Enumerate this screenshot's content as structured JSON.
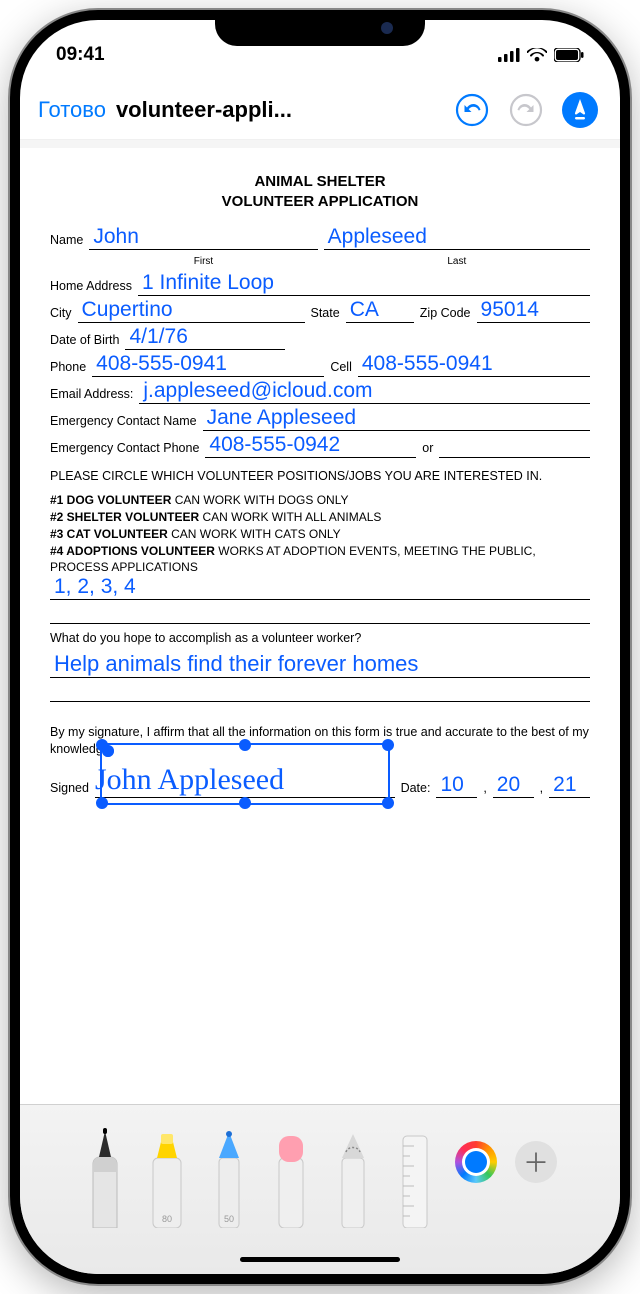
{
  "status": {
    "time": "09:41"
  },
  "nav": {
    "done": "Готово",
    "title": "volunteer-appli..."
  },
  "doc": {
    "heading1": "ANIMAL SHELTER",
    "heading2": "VOLUNTEER APPLICATION",
    "labels": {
      "name": "Name",
      "first": "First",
      "last": "Last",
      "home_address": "Home Address",
      "city": "City",
      "state": "State",
      "zip": "Zip Code",
      "dob": "Date of Birth",
      "phone": "Phone",
      "cell": "Cell",
      "email": "Email Address:",
      "ec_name": "Emergency Contact Name",
      "ec_phone": "Emergency Contact Phone",
      "or": "or",
      "signed": "Signed",
      "date": "Date:"
    },
    "values": {
      "first": "John",
      "last": "Appleseed",
      "address": "1 Infinite Loop",
      "city": "Cupertino",
      "state": "CA",
      "zip": "95014",
      "dob": "4/1/76",
      "phone": "408-555-0941",
      "cell": "408-555-0941",
      "email": "j.appleseed@icloud.com",
      "ec_name": "Jane Appleseed",
      "ec_phone": "408-555-0942",
      "positions": "1, 2, 3, 4",
      "accomplish": "Help animals find their forever homes",
      "signature": "John Appleseed",
      "date_m": "10",
      "date_d": "20",
      "date_y": "21"
    },
    "instr_positions": "PLEASE CIRCLE WHICH VOLUNTEER POSITIONS/JOBS YOU ARE INTERESTED IN.",
    "options": {
      "o1b": "#1 DOG VOLUNTEER",
      "o1r": " CAN WORK WITH DOGS ONLY",
      "o2b": "#2 SHELTER VOLUNTEER",
      "o2r": " CAN WORK WITH ALL ANIMALS",
      "o3b": "#3 CAT VOLUNTEER",
      "o3r": " CAN WORK WITH CATS ONLY",
      "o4b": "#4 ADOPTIONS VOLUNTEER",
      "o4r": " WORKS AT ADOPTION EVENTS, MEETING THE PUBLIC, PROCESS APPLICATIONS"
    },
    "question": "What do you hope to accomplish as a volunteer worker?",
    "affirm": "By my signature, I affirm that all the information on this form is true and accurate to the best of my knowledge."
  },
  "toolbar": {
    "highlighter_num": "80",
    "pencil_num": "50"
  }
}
